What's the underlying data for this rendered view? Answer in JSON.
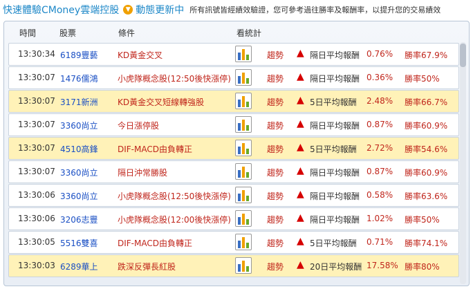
{
  "banner": {
    "title": "快速體驗CMoney雲端控股",
    "arrow_icon": "chevron-down-icon",
    "subtitle": "動態更新中",
    "note": "所有訊號皆經績效驗證，您可參考過往勝率及報酬率，以提升您的交易績效"
  },
  "table": {
    "headers": {
      "time": "時間",
      "stock": "股票",
      "condition": "條件",
      "chart": "看統計"
    },
    "rows": [
      {
        "time": "13:30:34",
        "stock": "6189豐藝",
        "condition": "KD黃金交叉",
        "trend": "趨勢",
        "label": "隔日平均報酬",
        "ret": "0.76%",
        "win": "勝率67.9%",
        "highlight": false
      },
      {
        "time": "13:30:07",
        "stock": "1476儒鴻",
        "condition": "小虎隊概念股(12:50後快漲停)",
        "trend": "趨勢",
        "label": "隔日平均報酬",
        "ret": "0.36%",
        "win": "勝率50%",
        "highlight": false
      },
      {
        "time": "13:30:07",
        "stock": "3171新洲",
        "condition": "KD黃金交叉短線轉強股",
        "trend": "趨勢",
        "label": "5日平均報酬",
        "ret": "2.48%",
        "win": "勝率66.7%",
        "highlight": true
      },
      {
        "time": "13:30:07",
        "stock": "3360尚立",
        "condition": "今日漲停股",
        "trend": "趨勢",
        "label": "隔日平均報酬",
        "ret": "0.87%",
        "win": "勝率60.9%",
        "highlight": false
      },
      {
        "time": "13:30:07",
        "stock": "4510高鋒",
        "condition": "DIF-MACD由負轉正",
        "trend": "趨勢",
        "label": "5日平均報酬",
        "ret": "2.72%",
        "win": "勝率54.6%",
        "highlight": true
      },
      {
        "time": "13:30:07",
        "stock": "3360尚立",
        "condition": "隔日沖常勝股",
        "trend": "趨勢",
        "label": "隔日平均報酬",
        "ret": "0.87%",
        "win": "勝率60.9%",
        "highlight": false
      },
      {
        "time": "13:30:06",
        "stock": "3360尚立",
        "condition": "小虎隊概念股(12:50後快漲停)",
        "trend": "趨勢",
        "label": "隔日平均報酬",
        "ret": "0.58%",
        "win": "勝率63.6%",
        "highlight": false
      },
      {
        "time": "13:30:06",
        "stock": "3206志豐",
        "condition": "小虎隊概念股(12:00後快漲停)",
        "trend": "趨勢",
        "label": "隔日平均報酬",
        "ret": "1.02%",
        "win": "勝率50%",
        "highlight": false
      },
      {
        "time": "13:30:05",
        "stock": "5516雙喜",
        "condition": "DIF-MACD由負轉正",
        "trend": "趨勢",
        "label": "5日平均報酬",
        "ret": "0.71%",
        "win": "勝率74.1%",
        "highlight": false
      },
      {
        "time": "13:30:03",
        "stock": "6289華上",
        "condition": "跌深反彈長紅股",
        "trend": "趨勢",
        "label": "20日平均報酬",
        "ret": "17.58%",
        "win": "勝率80%",
        "highlight": true
      }
    ]
  },
  "icons": {
    "chart": "bar-chart-icon",
    "up": "up-arrow-icon"
  },
  "colors": {
    "accent": "#1e88c8",
    "highlight_row": "#fff2b8",
    "up_arrow": "#d60000",
    "condition_text": "#c0261c",
    "stock_text": "#1a4fc4"
  }
}
